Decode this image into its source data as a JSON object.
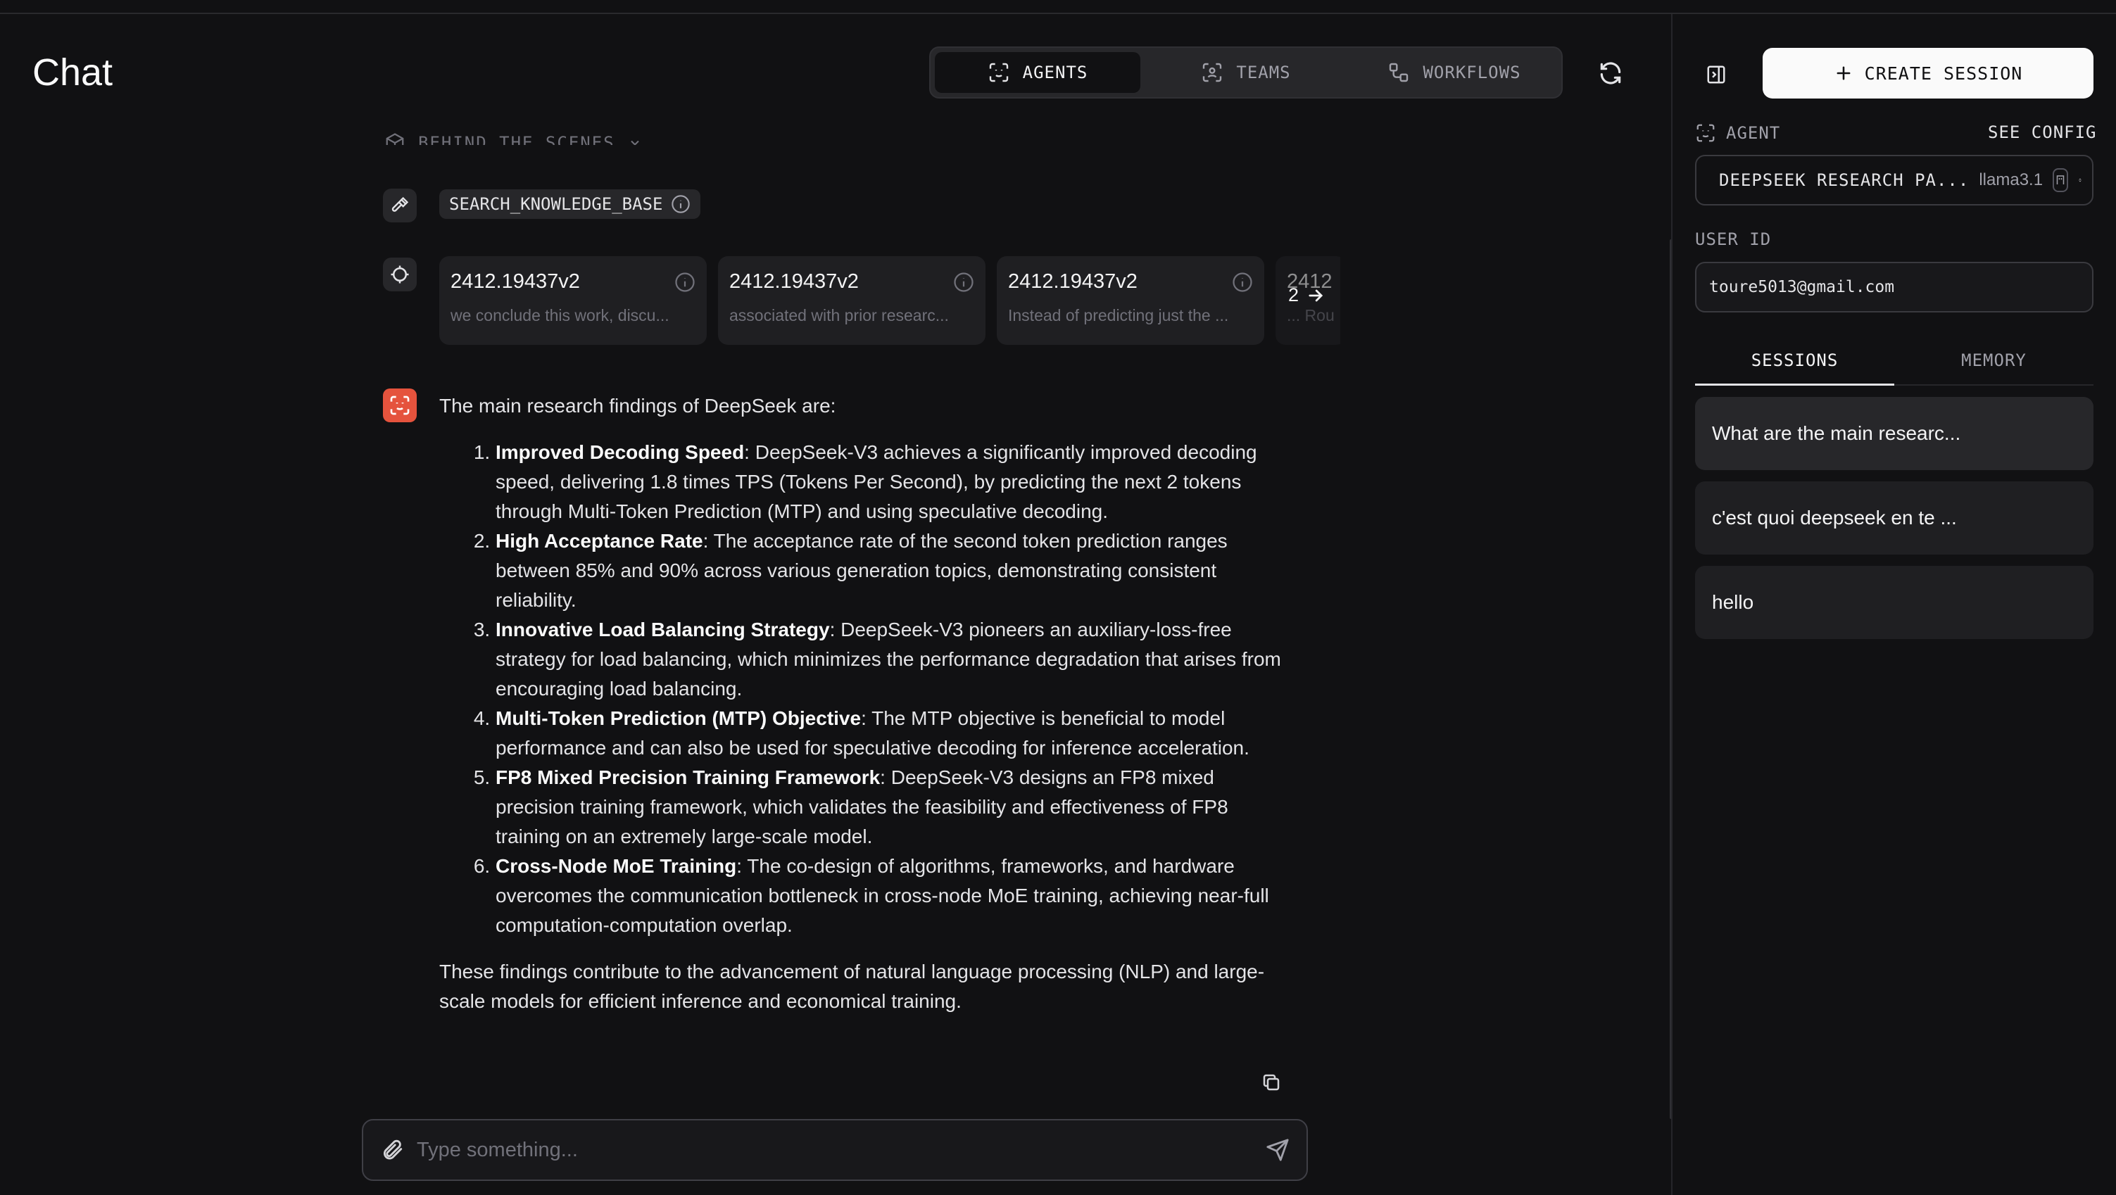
{
  "header": {
    "title": "Chat",
    "modes": [
      {
        "label": "AGENTS",
        "active": true,
        "icon": "agent-icon"
      },
      {
        "label": "TEAMS",
        "active": false,
        "icon": "team-icon"
      },
      {
        "label": "WORKFLOWS",
        "active": false,
        "icon": "workflow-icon"
      }
    ]
  },
  "chat": {
    "behind_the_scenes": "BEHIND THE SCENES",
    "tool_call": "SEARCH_KNOWLEDGE_BASE",
    "references": [
      {
        "title": "2412.19437v2",
        "snippet": "we conclude this work, discu..."
      },
      {
        "title": "2412.19437v2",
        "snippet": "associated with prior researc..."
      },
      {
        "title": "2412.19437v2",
        "snippet": "Instead of predicting just the ..."
      },
      {
        "title": "2412",
        "snippet": "... Rou"
      }
    ],
    "references_more": "2",
    "answer": {
      "intro": "The main research findings of DeepSeek are:",
      "items": [
        {
          "heading": "Improved Decoding Speed",
          "text": ": DeepSeek-V3 achieves a significantly improved decoding speed, delivering 1.8 times TPS (Tokens Per Second), by predicting the next 2 tokens through Multi-Token Prediction (MTP) and using speculative decoding."
        },
        {
          "heading": "High Acceptance Rate",
          "text": ": The acceptance rate of the second token prediction ranges between 85% and 90% across various generation topics, demonstrating consistent reliability."
        },
        {
          "heading": "Innovative Load Balancing Strategy",
          "text": ": DeepSeek-V3 pioneers an auxiliary-loss-free strategy for load balancing, which minimizes the performance degradation that arises from encouraging load balancing."
        },
        {
          "heading": "Multi-Token Prediction (MTP) Objective",
          "text": ": The MTP objective is beneficial to model performance and can also be used for speculative decoding for inference acceleration."
        },
        {
          "heading": "FP8 Mixed Precision Training Framework",
          "text": ": DeepSeek-V3 designs an FP8 mixed precision training framework, which validates the feasibility and effectiveness of FP8 training on an extremely large-scale model."
        },
        {
          "heading": "Cross-Node MoE Training",
          "text": ": The co-design of algorithms, frameworks, and hardware overcomes the communication bottleneck in cross-node MoE training, achieving near-full computation-computation overlap."
        }
      ],
      "conclusion": "These findings contribute to the advancement of natural language processing (NLP) and large-scale models for efficient inference and economical training."
    },
    "input_placeholder": "Type something..."
  },
  "sidebar": {
    "create_session": "CREATE SESSION",
    "agent_label": "AGENT",
    "see_config": "SEE CONFIG",
    "agent_name": "DEEPSEEK RESEARCH PA...",
    "agent_model": "llama3.1",
    "user_id_label": "USER ID",
    "user_id": "toure5013@gmail.com",
    "tabs": [
      {
        "label": "SESSIONS",
        "active": true
      },
      {
        "label": "MEMORY",
        "active": false
      }
    ],
    "sessions": [
      {
        "title": "What are the main researc..."
      },
      {
        "title": "c'est quoi deepseek en te ..."
      },
      {
        "title": "hello"
      }
    ]
  },
  "colors": {
    "background": "#111113",
    "agent_avatar": "#e5533d",
    "create_button": "#fafafa"
  }
}
